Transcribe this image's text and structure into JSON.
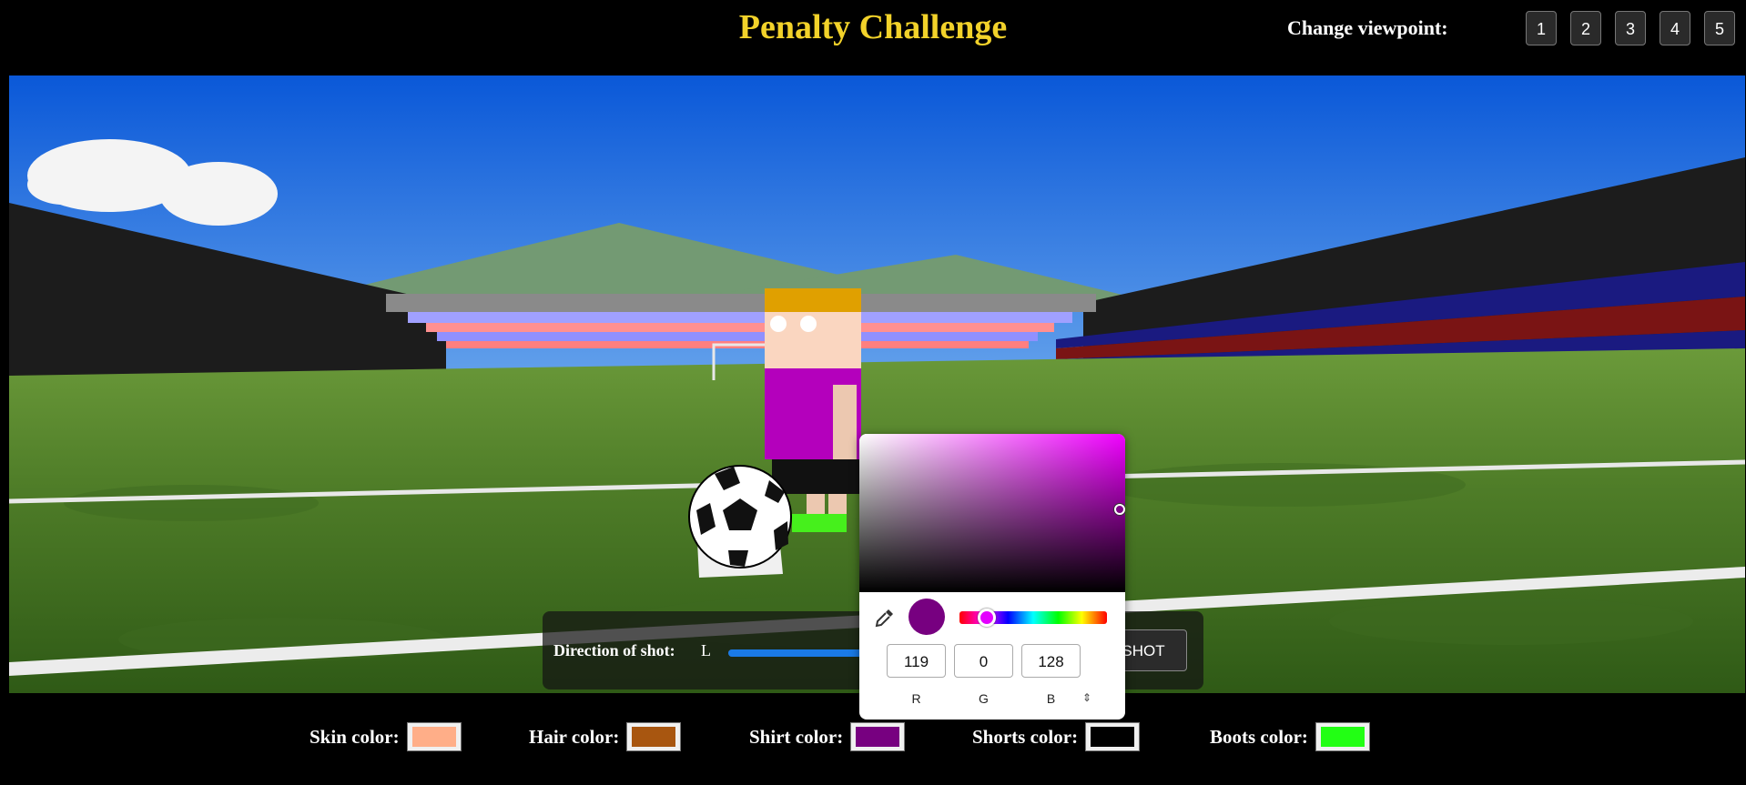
{
  "header": {
    "title": "Penalty Challenge",
    "viewpoint_label": "Change viewpoint:",
    "viewpoints": [
      "1",
      "2",
      "3",
      "4",
      "5"
    ]
  },
  "controls": {
    "direction_label": "Direction of shot:",
    "left_marker": "L",
    "direction_value_fraction": 0.45,
    "shoot_button_label": "SHOT"
  },
  "color_picker": {
    "r_value": "119",
    "g_value": "0",
    "b_value": "128",
    "r_label": "R",
    "g_label": "G",
    "b_label": "B",
    "mode_toggle": "⇕",
    "current_color": "#770080"
  },
  "player_colors": {
    "skin": {
      "label": "Skin color:",
      "color": "#ffae88"
    },
    "hair": {
      "label": "Hair color:",
      "color": "#a85610"
    },
    "shirt": {
      "label": "Shirt color:",
      "color": "#770080"
    },
    "shorts": {
      "label": "Shorts color:",
      "color": "#000000"
    },
    "boots": {
      "label": "Boots color:",
      "color": "#22ff14"
    }
  },
  "icons": {
    "eyedropper": "eyedropper-icon"
  }
}
